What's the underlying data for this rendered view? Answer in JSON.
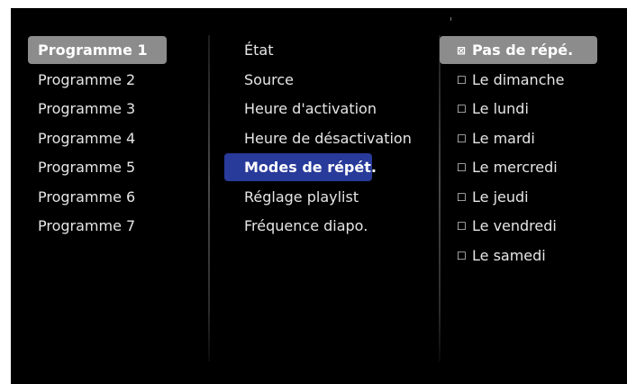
{
  "programmes": {
    "items": [
      {
        "label": "Programme 1"
      },
      {
        "label": "Programme 2"
      },
      {
        "label": "Programme 3"
      },
      {
        "label": "Programme 4"
      },
      {
        "label": "Programme 5"
      },
      {
        "label": "Programme 6"
      },
      {
        "label": "Programme 7"
      }
    ],
    "selected_index": 0
  },
  "settings": {
    "items": [
      {
        "label": "État"
      },
      {
        "label": "Source"
      },
      {
        "label": "Heure d'activation"
      },
      {
        "label": "Heure de désactivation"
      },
      {
        "label": "Modes de répét."
      },
      {
        "label": "Réglage playlist"
      },
      {
        "label": "Fréquence diapo."
      }
    ],
    "selected_index": 4
  },
  "repeat_options": {
    "items": [
      {
        "label": "Pas de répé.",
        "checked": true,
        "box": "⊠"
      },
      {
        "label": "Le dimanche",
        "checked": false,
        "box": "☐"
      },
      {
        "label": "Le lundi",
        "checked": false,
        "box": "☐"
      },
      {
        "label": "Le mardi",
        "checked": false,
        "box": "☐"
      },
      {
        "label": "Le mercredi",
        "checked": false,
        "box": "☐"
      },
      {
        "label": "Le jeudi",
        "checked": false,
        "box": "☐"
      },
      {
        "label": "Le vendredi",
        "checked": false,
        "box": "☐"
      },
      {
        "label": "Le samedi",
        "checked": false,
        "box": "☐"
      }
    ],
    "selected_index": 0
  },
  "colors": {
    "background": "#000000",
    "selected_gray": "#8c8c8c",
    "selected_blue": "#283a9a",
    "text": "#e6e6e6"
  }
}
